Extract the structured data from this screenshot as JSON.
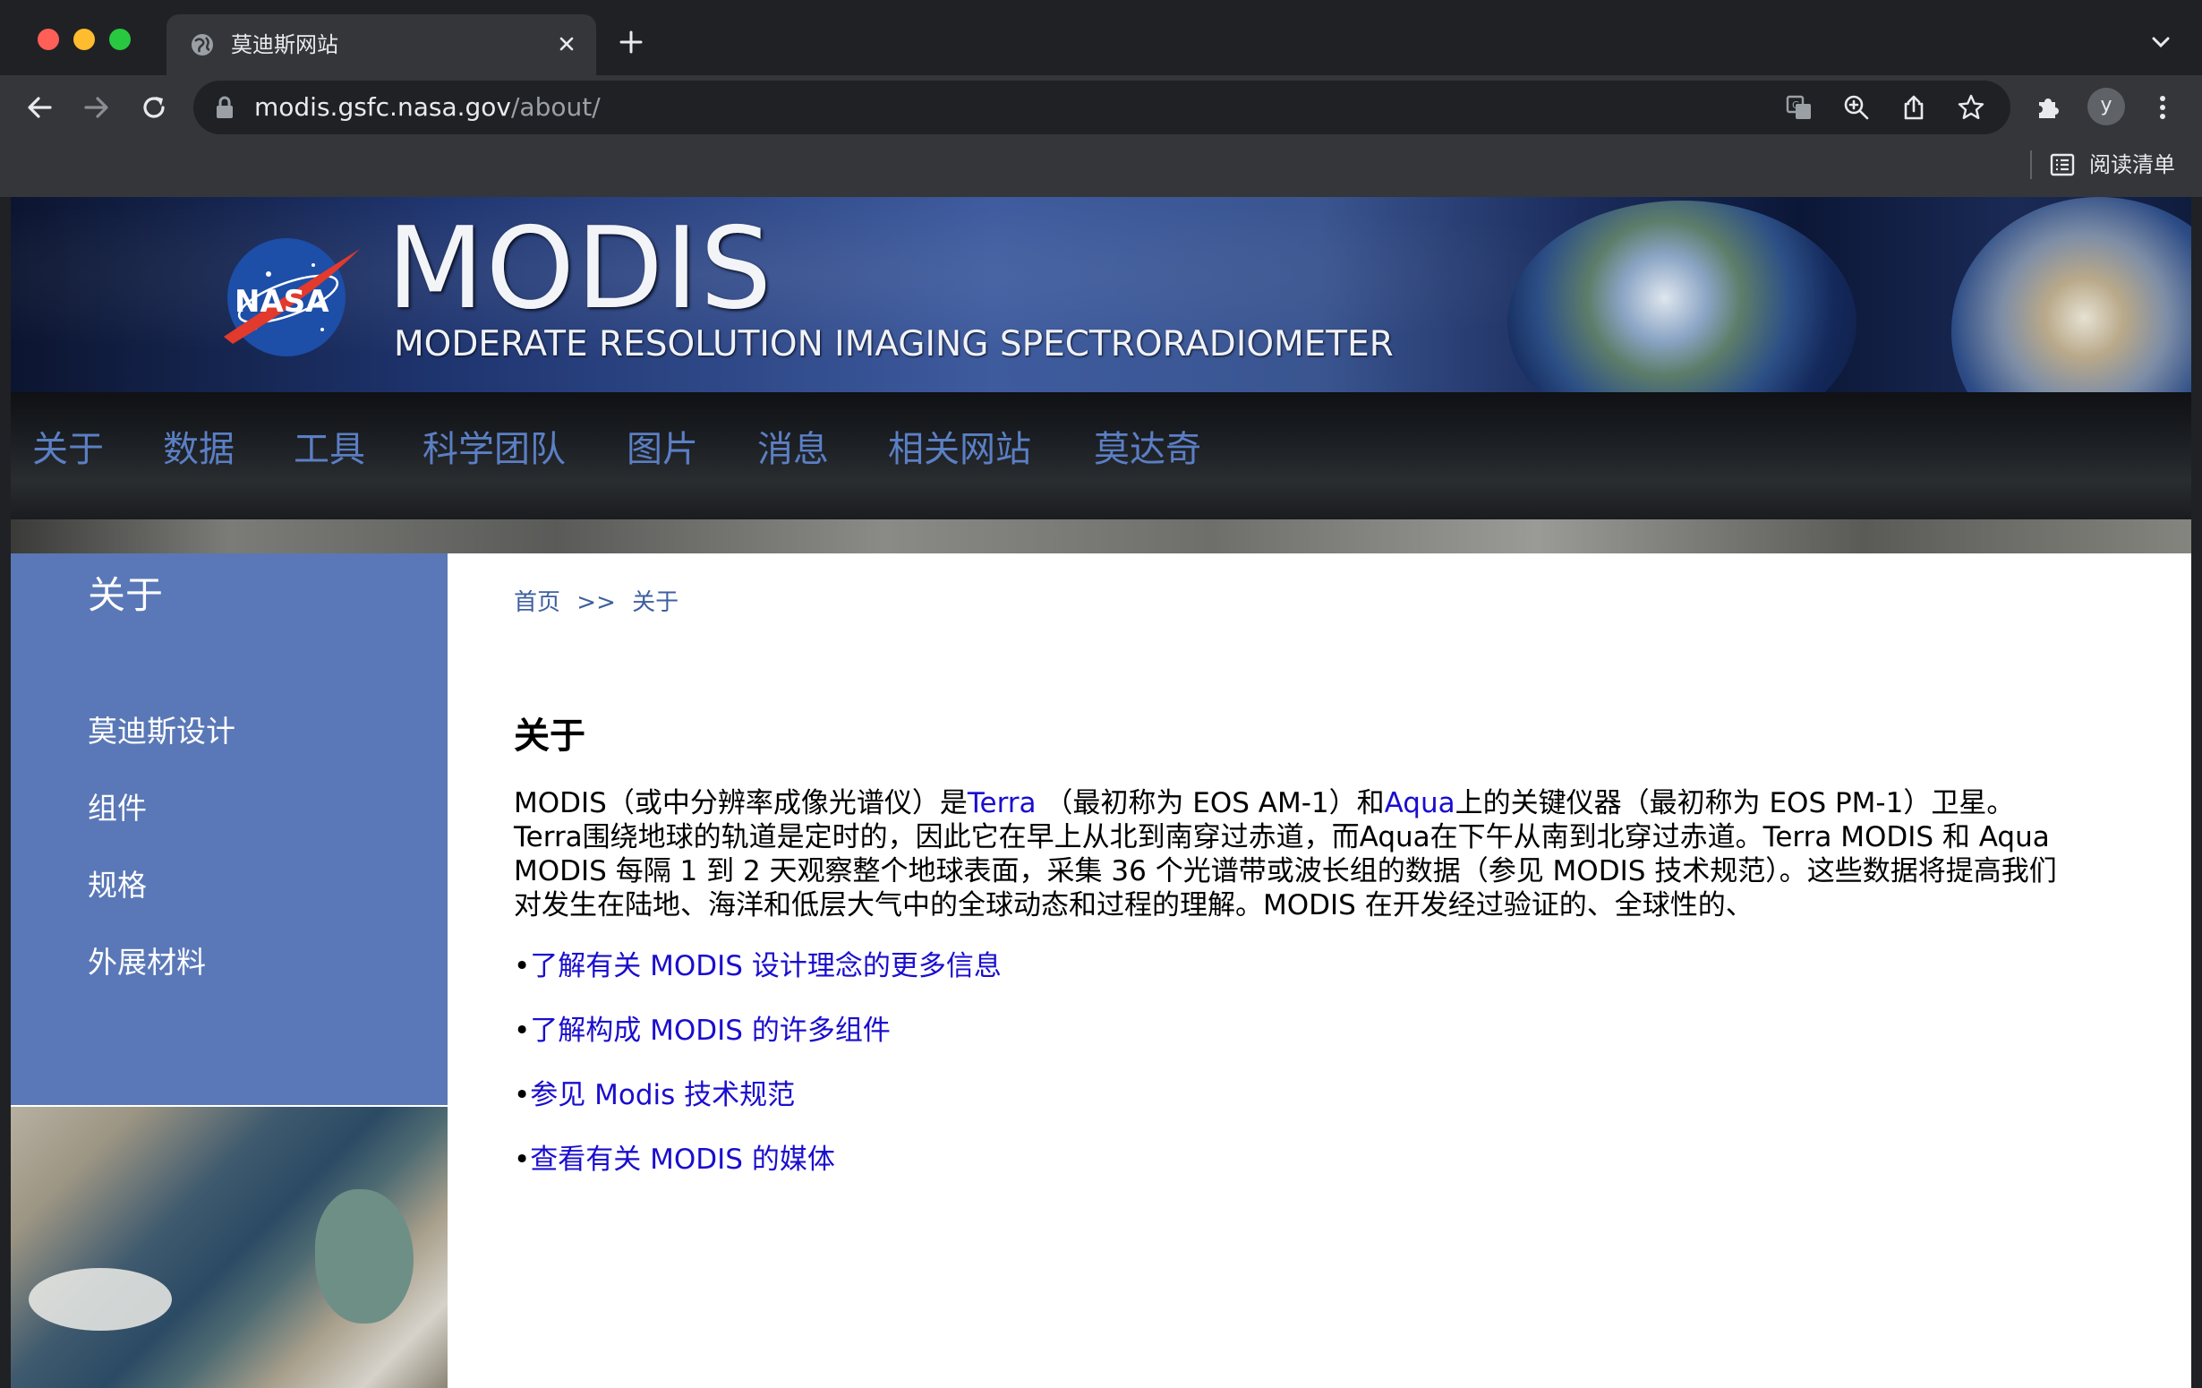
{
  "browser": {
    "tab_title": "莫迪斯网站",
    "url_host": "modis.gsfc.nasa.gov",
    "url_path": "/about/",
    "profile_initial": "y",
    "reading_list_label": "阅读清单",
    "icons": [
      "globe-icon",
      "close-icon",
      "plus-icon",
      "chevron-down-icon",
      "back-icon",
      "forward-icon",
      "reload-icon",
      "lock-icon",
      "translate-icon",
      "zoom-icon",
      "share-icon",
      "star-icon",
      "extensions-icon",
      "more-icon",
      "reading-list-icon"
    ]
  },
  "banner": {
    "logo_text": "NASA",
    "title": "MODIS",
    "subtitle": "MODERATE RESOLUTION IMAGING SPECTRORADIOMETER"
  },
  "nav": {
    "items": [
      "关于",
      "数据",
      "工具",
      "科学团队",
      "图片",
      "消息",
      "相关网站",
      "莫达奇"
    ]
  },
  "sidebar": {
    "title": "关于",
    "links": [
      "莫迪斯设计",
      "组件",
      "规格",
      "外展材料"
    ]
  },
  "breadcrumb": {
    "home": "首页",
    "separator": ">>",
    "current": "关于"
  },
  "main": {
    "heading": "关于",
    "para_line1_a": "MODIS（或中分辨率成像光谱仪）是",
    "para_link_terra": "Terra",
    "para_line1_b": " （最初称为 EOS AM-1）和",
    "para_link_aqua": "Aqua",
    "para_line1_c": "上的关键仪器（最初称为 EOS PM-1）卫星。",
    "para_line2": "Terra围绕地球的轨道是定时的，因此它在早上从北到南穿过赤道，而Aqua在下午从南到北穿过赤道。Terra MODIS 和 Aqua",
    "para_line3": "MODIS 每隔 1 到 2 天观察整个地球表面，采集 36 个光谱带或波长组的数据（参见 MODIS 技术规范）。这些数据将提高我们",
    "para_line4": "对发生在陆地、海洋和低层大气中的全球动态和过程的理解。MODIS 在开发经过验证的、全球性的、",
    "bullet_symbol": "•",
    "links": [
      "了解有关 MODIS 设计理念的更多信息",
      "了解构成 MODIS 的许多组件",
      "参见 Modis 技术规范",
      "查看有关 MODIS 的媒体"
    ]
  },
  "colors": {
    "nav_link": "#5b7fc4",
    "sidebar_bg": "#5a78b7",
    "body_link": "#1a0dce",
    "breadcrumb": "#3d5fa0"
  }
}
